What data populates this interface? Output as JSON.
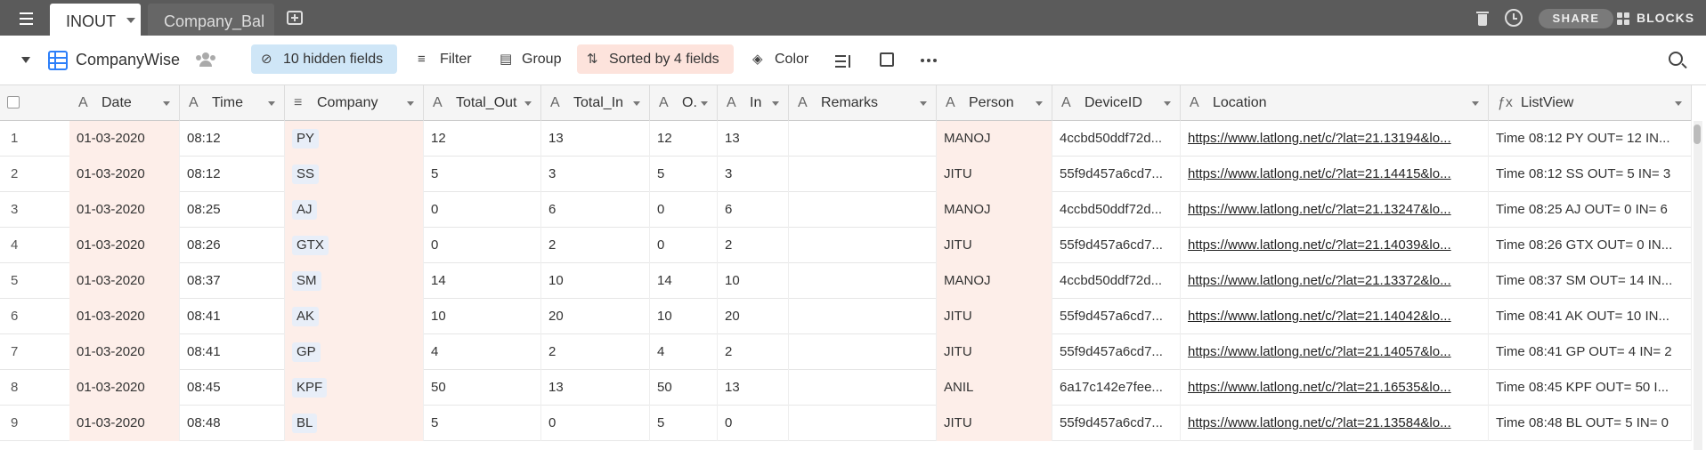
{
  "tabs": {
    "active": "INOUT",
    "other": "Company_Bal",
    "share_label": "SHARE",
    "blocks_label": "BLOCKS"
  },
  "toolbar": {
    "view_name": "CompanyWise",
    "hidden_fields": "10 hidden fields",
    "filter": "Filter",
    "group": "Group",
    "sorted": "Sorted by 4 fields",
    "color": "Color"
  },
  "columns": [
    {
      "key": "date",
      "label": "Date",
      "icon": "A"
    },
    {
      "key": "time",
      "label": "Time",
      "icon": "A"
    },
    {
      "key": "company",
      "label": "Company",
      "icon": "≡"
    },
    {
      "key": "total_out",
      "label": "Total_Out",
      "icon": "A"
    },
    {
      "key": "total_in",
      "label": "Total_In",
      "icon": "A"
    },
    {
      "key": "o",
      "label": "O.",
      "icon": "A"
    },
    {
      "key": "in",
      "label": "In",
      "icon": "A"
    },
    {
      "key": "remarks",
      "label": "Remarks",
      "icon": "A"
    },
    {
      "key": "person",
      "label": "Person",
      "icon": "A"
    },
    {
      "key": "device",
      "label": "DeviceID",
      "icon": "A"
    },
    {
      "key": "location",
      "label": "Location",
      "icon": "A"
    },
    {
      "key": "listview",
      "label": "ListView",
      "icon": "fx"
    }
  ],
  "rows": [
    {
      "n": "1",
      "date": "01-03-2020",
      "time": "08:12",
      "company": "PY",
      "total_out": "12",
      "total_in": "13",
      "o": "12",
      "in": "13",
      "remarks": "",
      "person": "MANOJ",
      "device": "4ccbd50ddf72d...",
      "location": "https://www.latlong.net/c/?lat=21.13194&lo...",
      "listview": "Time 08:12 PY OUT= 12 IN..."
    },
    {
      "n": "2",
      "date": "01-03-2020",
      "time": "08:12",
      "company": "SS",
      "total_out": "5",
      "total_in": "3",
      "o": "5",
      "in": "3",
      "remarks": "",
      "person": "JITU",
      "device": "55f9d457a6cd7...",
      "location": "https://www.latlong.net/c/?lat=21.14415&lo...",
      "listview": "Time 08:12 SS OUT= 5 IN= 3"
    },
    {
      "n": "3",
      "date": "01-03-2020",
      "time": "08:25",
      "company": "AJ",
      "total_out": "0",
      "total_in": "6",
      "o": "0",
      "in": "6",
      "remarks": "",
      "person": "MANOJ",
      "device": "4ccbd50ddf72d...",
      "location": "https://www.latlong.net/c/?lat=21.13247&lo...",
      "listview": "Time 08:25 AJ OUT= 0 IN= 6"
    },
    {
      "n": "4",
      "date": "01-03-2020",
      "time": "08:26",
      "company": "GTX",
      "total_out": "0",
      "total_in": "2",
      "o": "0",
      "in": "2",
      "remarks": "",
      "person": "JITU",
      "device": "55f9d457a6cd7...",
      "location": "https://www.latlong.net/c/?lat=21.14039&lo...",
      "listview": "Time 08:26 GTX OUT= 0 IN..."
    },
    {
      "n": "5",
      "date": "01-03-2020",
      "time": "08:37",
      "company": "SM",
      "total_out": "14",
      "total_in": "10",
      "o": "14",
      "in": "10",
      "remarks": "",
      "person": "MANOJ",
      "device": "4ccbd50ddf72d...",
      "location": "https://www.latlong.net/c/?lat=21.13372&lo...",
      "listview": "Time 08:37 SM OUT= 14 IN..."
    },
    {
      "n": "6",
      "date": "01-03-2020",
      "time": "08:41",
      "company": "AK",
      "total_out": "10",
      "total_in": "20",
      "o": "10",
      "in": "20",
      "remarks": "",
      "person": "JITU",
      "device": "55f9d457a6cd7...",
      "location": "https://www.latlong.net/c/?lat=21.14042&lo...",
      "listview": "Time 08:41 AK OUT= 10 IN..."
    },
    {
      "n": "7",
      "date": "01-03-2020",
      "time": "08:41",
      "company": "GP",
      "total_out": "4",
      "total_in": "2",
      "o": "4",
      "in": "2",
      "remarks": "",
      "person": "JITU",
      "device": "55f9d457a6cd7...",
      "location": "https://www.latlong.net/c/?lat=21.14057&lo...",
      "listview": "Time 08:41 GP OUT= 4 IN= 2"
    },
    {
      "n": "8",
      "date": "01-03-2020",
      "time": "08:45",
      "company": "KPF",
      "total_out": "50",
      "total_in": "13",
      "o": "50",
      "in": "13",
      "remarks": "",
      "person": "ANIL",
      "device": "6a17c142e7fee...",
      "location": "https://www.latlong.net/c/?lat=21.16535&lo...",
      "listview": "Time 08:45 KPF OUT= 50 I..."
    },
    {
      "n": "9",
      "date": "01-03-2020",
      "time": "08:48",
      "company": "BL",
      "total_out": "5",
      "total_in": "0",
      "o": "5",
      "in": "0",
      "remarks": "",
      "person": "JITU",
      "device": "55f9d457a6cd7...",
      "location": "https://www.latlong.net/c/?lat=21.13584&lo...",
      "listview": "Time 08:48 BL OUT= 5 IN= 0"
    }
  ]
}
